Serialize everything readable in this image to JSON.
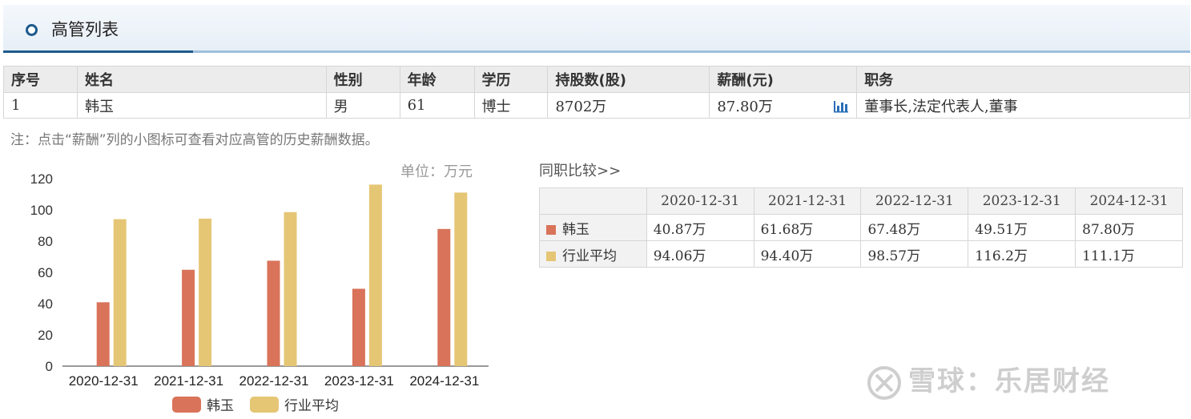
{
  "header": {
    "title": "高管列表"
  },
  "exec_table": {
    "columns": [
      "序号",
      "姓名",
      "性别",
      "年龄",
      "学历",
      "持股数(股)",
      "薪酬(元)",
      "职务"
    ],
    "rows": [
      {
        "index": "1",
        "name": "韩玉",
        "gender": "男",
        "age": "61",
        "education": "博士",
        "shares": "8702万",
        "salary": "87.80万",
        "position": "董事长,法定代表人,董事"
      }
    ]
  },
  "note": "注：点击“薪酬”列的小图标可查看对应高管的历史薪酬数据。",
  "unit_label": "单位：万元",
  "compare": {
    "title": "同职比较>>",
    "years": [
      "2020-12-31",
      "2021-12-31",
      "2022-12-31",
      "2023-12-31",
      "2024-12-31"
    ],
    "rows": [
      {
        "label": "韩玉",
        "values": [
          "40.87万",
          "61.68万",
          "67.48万",
          "49.51万",
          "87.80万"
        ]
      },
      {
        "label": "行业平均",
        "values": [
          "94.06万",
          "94.40万",
          "98.57万",
          "116.2万",
          "111.1万"
        ]
      }
    ]
  },
  "colors": {
    "series1": "#d9735a",
    "series2": "#e5c675",
    "accent": "#1e5a8c"
  },
  "chart_data": {
    "type": "bar",
    "categories": [
      "2020-12-31",
      "2021-12-31",
      "2022-12-31",
      "2023-12-31",
      "2024-12-31"
    ],
    "series": [
      {
        "name": "韩玉",
        "values": [
          40.87,
          61.68,
          67.48,
          49.51,
          87.8
        ]
      },
      {
        "name": "行业平均",
        "values": [
          94.06,
          94.4,
          98.57,
          116.2,
          111.1
        ]
      }
    ],
    "ylim": [
      0,
      120
    ],
    "yticks": [
      0,
      20,
      40,
      60,
      80,
      100,
      120
    ],
    "legend": "bottom",
    "grid": false
  },
  "watermark": "雪球：乐居财经"
}
